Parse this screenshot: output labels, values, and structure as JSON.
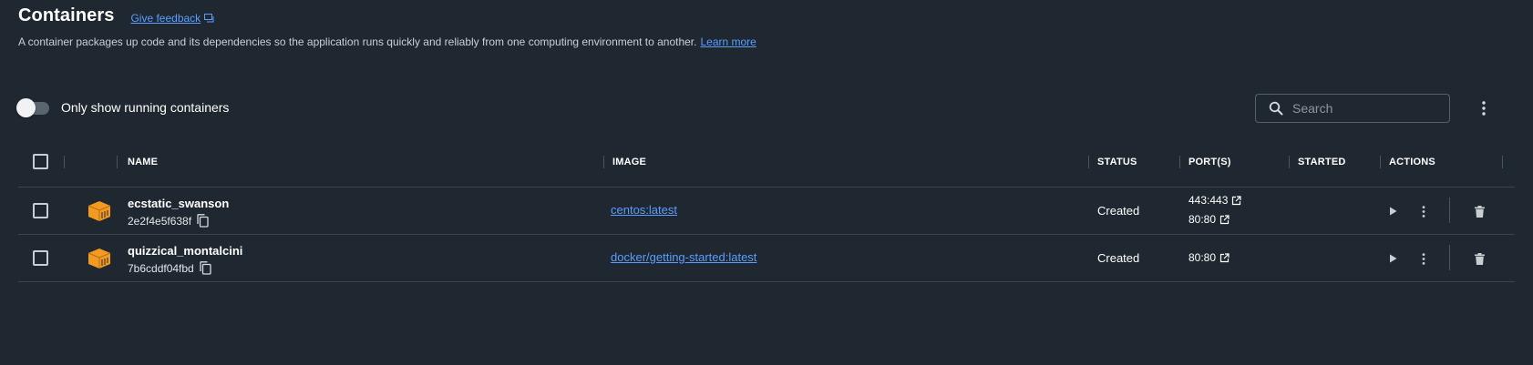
{
  "header": {
    "title": "Containers",
    "feedback_label": "Give feedback",
    "description": "A container packages up code and its dependencies so the application runs quickly and reliably from one computing environment to another.",
    "learn_more_label": "Learn more"
  },
  "toolbar": {
    "toggle_label": "Only show running containers",
    "toggle_on": false,
    "search_placeholder": "Search"
  },
  "table": {
    "columns": {
      "name": "NAME",
      "image": "IMAGE",
      "status": "STATUS",
      "ports": "PORT(S)",
      "started": "STARTED",
      "actions": "ACTIONS"
    },
    "rows": [
      {
        "name": "ecstatic_swanson",
        "id": "2e2f4e5f638f",
        "image": "centos:latest",
        "status": "Created",
        "ports": [
          "443:443",
          "80:80"
        ],
        "started": ""
      },
      {
        "name": "quizzical_montalcini",
        "id": "7b6cddf04fbd",
        "image": "docker/getting-started:latest",
        "status": "Created",
        "ports": [
          "80:80"
        ],
        "started": ""
      }
    ]
  },
  "colors": {
    "background": "#1f2830",
    "link": "#5b9dff",
    "container_icon": "#f39a23"
  },
  "icons": [
    "external-link-icon",
    "search-icon",
    "more-vertical-icon",
    "container-icon",
    "copy-icon",
    "play-icon",
    "trash-icon"
  ]
}
